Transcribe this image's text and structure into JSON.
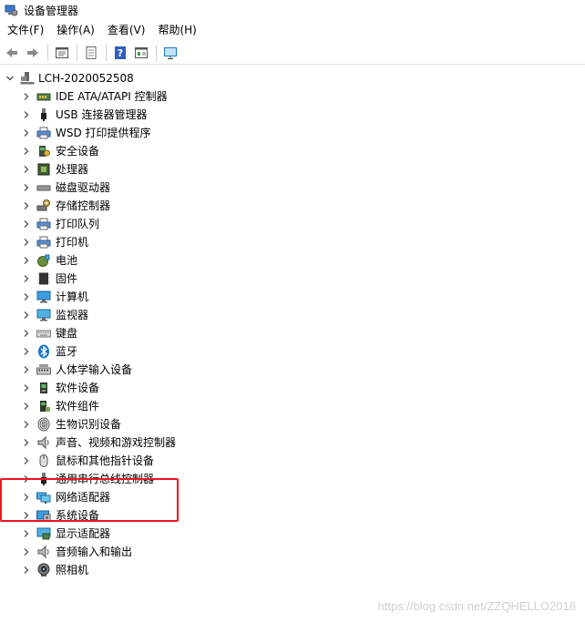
{
  "window": {
    "title": "设备管理器"
  },
  "menu": [
    {
      "label": "文件(F)"
    },
    {
      "label": "操作(A)"
    },
    {
      "label": "查看(V)"
    },
    {
      "label": "帮助(H)"
    }
  ],
  "toolbar": {
    "buttons": [
      {
        "icon": "back-arrow-icon"
      },
      {
        "icon": "forward-arrow-icon"
      },
      {
        "icon": "properties-icon"
      },
      {
        "icon": "page-icon"
      },
      {
        "icon": "help-icon"
      },
      {
        "icon": "view-icon"
      },
      {
        "icon": "monitor-icon"
      }
    ]
  },
  "tree": {
    "root": {
      "label": "LCH-2020052508",
      "icon": "computer-root-icon",
      "expanded": true
    },
    "items": [
      {
        "label": "IDE ATA/ATAPI 控制器",
        "icon": "ide-controller-icon"
      },
      {
        "label": "USB 连接器管理器",
        "icon": "usb-icon"
      },
      {
        "label": "WSD 打印提供程序",
        "icon": "printer-icon"
      },
      {
        "label": "安全设备",
        "icon": "security-device-icon"
      },
      {
        "label": "处理器",
        "icon": "processor-icon"
      },
      {
        "label": "磁盘驱动器",
        "icon": "disk-drive-icon"
      },
      {
        "label": "存储控制器",
        "icon": "storage-controller-icon"
      },
      {
        "label": "打印队列",
        "icon": "printer-icon"
      },
      {
        "label": "打印机",
        "icon": "printer-icon"
      },
      {
        "label": "电池",
        "icon": "battery-icon"
      },
      {
        "label": "固件",
        "icon": "firmware-icon"
      },
      {
        "label": "计算机",
        "icon": "computer-icon"
      },
      {
        "label": "监视器",
        "icon": "monitor-icon"
      },
      {
        "label": "键盘",
        "icon": "keyboard-icon"
      },
      {
        "label": "蓝牙",
        "icon": "bluetooth-icon"
      },
      {
        "label": "人体学输入设备",
        "icon": "hid-icon"
      },
      {
        "label": "软件设备",
        "icon": "software-device-icon"
      },
      {
        "label": "软件组件",
        "icon": "software-component-icon"
      },
      {
        "label": "生物识别设备",
        "icon": "fingerprint-icon"
      },
      {
        "label": "声音、视频和游戏控制器",
        "icon": "speaker-icon"
      },
      {
        "label": "鼠标和其他指针设备",
        "icon": "mouse-icon"
      },
      {
        "label": "通用串行总线控制器",
        "icon": "usb-icon"
      },
      {
        "label": "网络适配器",
        "icon": "network-adapter-icon"
      },
      {
        "label": "系统设备",
        "icon": "system-device-icon"
      },
      {
        "label": "显示适配器",
        "icon": "display-adapter-icon"
      },
      {
        "label": "音频输入和输出",
        "icon": "speaker-icon"
      },
      {
        "label": "照相机",
        "icon": "camera-icon"
      }
    ]
  },
  "watermark": "https://blog.csdn.net/ZZQHELLO2018",
  "colors": {
    "highlight": "#e8191f",
    "accent": "#1e74c9"
  }
}
